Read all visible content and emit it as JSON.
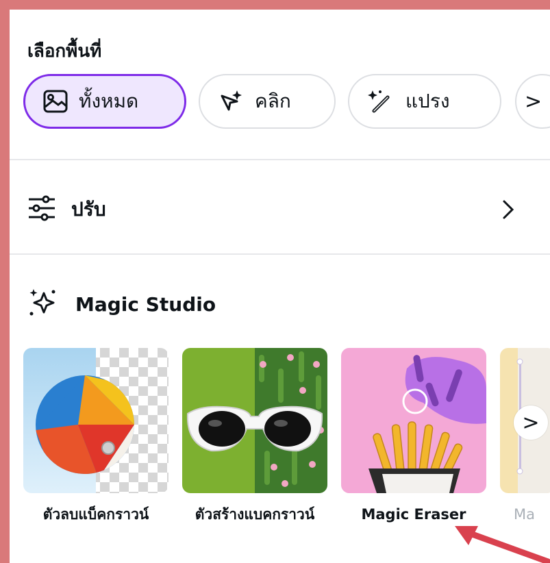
{
  "select_area": {
    "title": "เลือกพื้นที่",
    "chips": [
      {
        "label": "ทั้งหมด",
        "icon": "image-icon",
        "active": true
      },
      {
        "label": "คลิก",
        "icon": "sparkle-cursor-icon",
        "active": false
      },
      {
        "label": "แปรง",
        "icon": "magic-brush-icon",
        "active": false
      }
    ],
    "scroll_glyph": ">"
  },
  "adjust": {
    "label": "ปรับ",
    "icon": "sliders-icon",
    "chevron": ">"
  },
  "magic_studio": {
    "label": "Magic Studio",
    "icon": "sparkles-icon",
    "tools": [
      {
        "label": "ตัวลบแบ็คกราวน์",
        "image": "beach-ball-transparent-background"
      },
      {
        "label": "ตัวสร้างแบคกราวน์",
        "image": "sunglasses-on-grass-background"
      },
      {
        "label": "Magic Eraser",
        "image": "french-fries-pink-background"
      },
      {
        "label": "Ma",
        "image": "partial-tile"
      }
    ],
    "next_glyph": ">"
  },
  "colors": {
    "frame": "#d9797a",
    "accent": "#7d2ae8",
    "accent_bg": "#efe7fe",
    "arrow": "#d9414e"
  }
}
